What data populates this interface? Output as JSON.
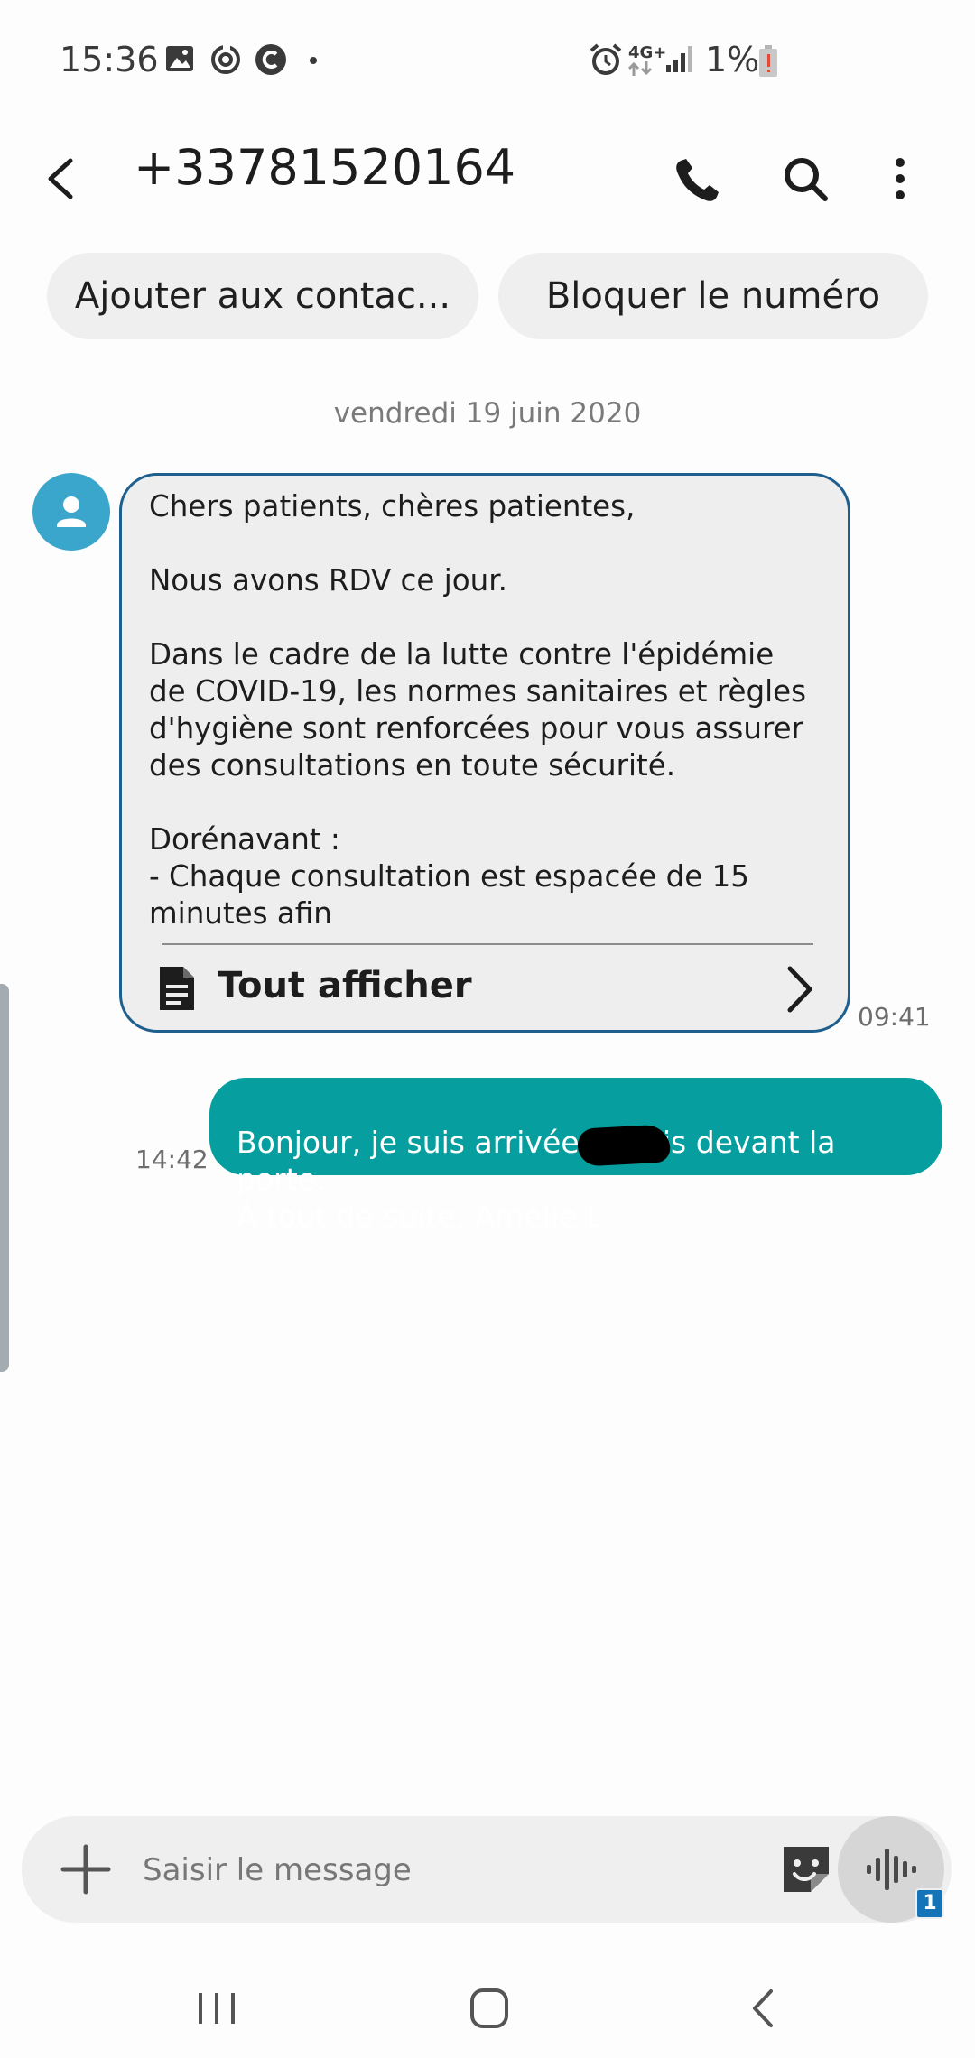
{
  "status_bar": {
    "time": "15:36",
    "network": "4G+",
    "battery": "1%",
    "icons": [
      "image-icon",
      "sync-icon",
      "c-app-icon",
      "dot-icon",
      "alarm-icon",
      "signal-icon",
      "battery-low-icon"
    ]
  },
  "header": {
    "title": "+33781520164",
    "icons": [
      "back-arrow-icon",
      "phone-icon",
      "search-icon",
      "more-vertical-icon"
    ]
  },
  "actions": {
    "add_contact": "Ajouter aux contac...",
    "block_number": "Bloquer le numéro"
  },
  "date_separator": "vendredi 19 juin 2020",
  "incoming": {
    "text": "Chers patients, chères patientes,\n\nNous avons RDV ce jour.\n\nDans le cadre de la lutte contre l'épidémie\nde COVID-19, les normes sanitaires et règles\nd'hygiène sont renforcées pour vous assurer\ndes consultations en toute sécurité.\n\nDorénavant :\n- Chaque consultation est espacée de 15\nminutes afin",
    "show_all": "Tout afficher",
    "time": "09:41"
  },
  "outgoing": {
    "text": "Bonjour,  je suis arrivée et suis devant la porte.\nÀ tout de suite,  Amélie L",
    "time": "14:42"
  },
  "composer": {
    "placeholder": "Saisir le message",
    "voice_badge": "1"
  },
  "colors": {
    "outgoing_bubble": "#069e9e",
    "incoming_border": "#1f5f8e",
    "avatar": "#3ba6cb",
    "badge": "#1573b8"
  }
}
